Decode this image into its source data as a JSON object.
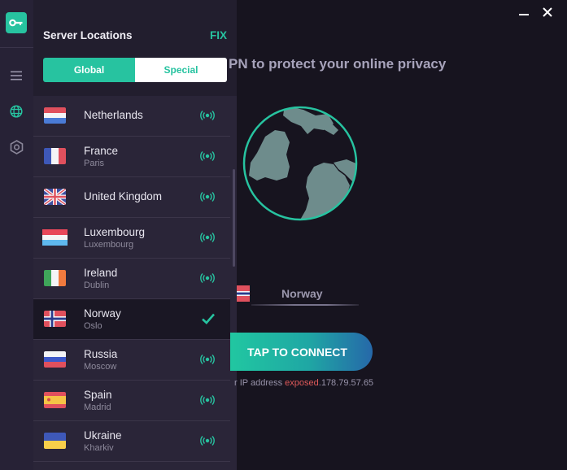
{
  "window": {
    "minimize_icon": "minimize-icon",
    "close_icon": "close-icon"
  },
  "rail": {
    "logo_icon": "key-icon",
    "items": [
      {
        "icon": "menu-icon",
        "active": false
      },
      {
        "icon": "globe-icon",
        "active": true
      },
      {
        "icon": "settings-hexagon-icon",
        "active": false
      }
    ]
  },
  "panel": {
    "title": "Server Locations",
    "fix_label": "FIX",
    "tabs": [
      {
        "label": "Global",
        "active": true
      },
      {
        "label": "Special",
        "active": false
      }
    ],
    "servers": [
      {
        "country": "Netherlands",
        "city": "",
        "flag": "nl",
        "selected": false,
        "status_icon": "signal-icon"
      },
      {
        "country": "France",
        "city": "Paris",
        "flag": "fr",
        "selected": false,
        "status_icon": "signal-icon"
      },
      {
        "country": "United Kingdom",
        "city": "",
        "flag": "gb",
        "selected": false,
        "status_icon": "signal-icon"
      },
      {
        "country": "Luxembourg",
        "city": "Luxembourg",
        "flag": "lu",
        "selected": false,
        "status_icon": "signal-icon"
      },
      {
        "country": "Ireland",
        "city": "Dublin",
        "flag": "ie",
        "selected": false,
        "status_icon": "signal-icon"
      },
      {
        "country": "Norway",
        "city": "Oslo",
        "flag": "no",
        "selected": true,
        "status_icon": "checkmark-icon"
      },
      {
        "country": "Russia",
        "city": "Moscow",
        "flag": "ru",
        "selected": false,
        "status_icon": "signal-icon"
      },
      {
        "country": "Spain",
        "city": "Madrid",
        "flag": "es",
        "selected": false,
        "status_icon": "signal-icon"
      },
      {
        "country": "Ukraine",
        "city": "Kharkiv",
        "flag": "ua",
        "selected": false,
        "status_icon": "signal-icon"
      }
    ]
  },
  "main": {
    "tagline": "PN to protect your online privacy",
    "selected_location": "Norway",
    "connect_label": "TAP TO CONNECT",
    "ip_prefix": "r IP address ",
    "ip_status": "exposed",
    "ip_address": ".178.79.57.65"
  },
  "colors": {
    "accent": "#27c3a0",
    "danger": "#e05a5a",
    "background": "#17141f",
    "panel": "#2a2538"
  }
}
